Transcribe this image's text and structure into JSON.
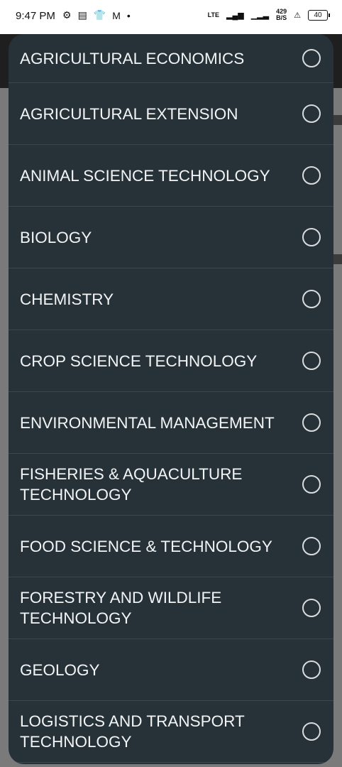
{
  "status_bar": {
    "time": "9:47 PM",
    "left_icons": [
      "settings-icon",
      "news-icon",
      "tshirt-icon",
      "gmail-icon",
      "dot-icon"
    ],
    "network": "LTE",
    "speed_value": "429",
    "speed_unit": "B/S",
    "battery": "40"
  },
  "dialog": {
    "options": [
      {
        "label": "AGRICULTURAL ECONOMICS"
      },
      {
        "label": "AGRICULTURAL EXTENSION"
      },
      {
        "label": "ANIMAL SCIENCE TECHNOLOGY"
      },
      {
        "label": "BIOLOGY"
      },
      {
        "label": "CHEMISTRY"
      },
      {
        "label": "CROP SCIENCE TECHNOLOGY"
      },
      {
        "label": "ENVIRONMENTAL MANAGEMENT"
      },
      {
        "label": "FISHERIES & AQUACULTURE TECHNOLOGY"
      },
      {
        "label": "FOOD SCIENCE & TECHNOLOGY"
      },
      {
        "label": "FORESTRY AND WILDLIFE TECHNOLOGY"
      },
      {
        "label": "GEOLOGY"
      },
      {
        "label": "LOGISTICS AND TRANSPORT TECHNOLOGY"
      }
    ]
  },
  "colors": {
    "dialog_bg": "#263238",
    "text": "#f2f4f5",
    "radio": "#d8dcde",
    "divider": "#3a474e",
    "scrim": "#7a7a7a"
  }
}
